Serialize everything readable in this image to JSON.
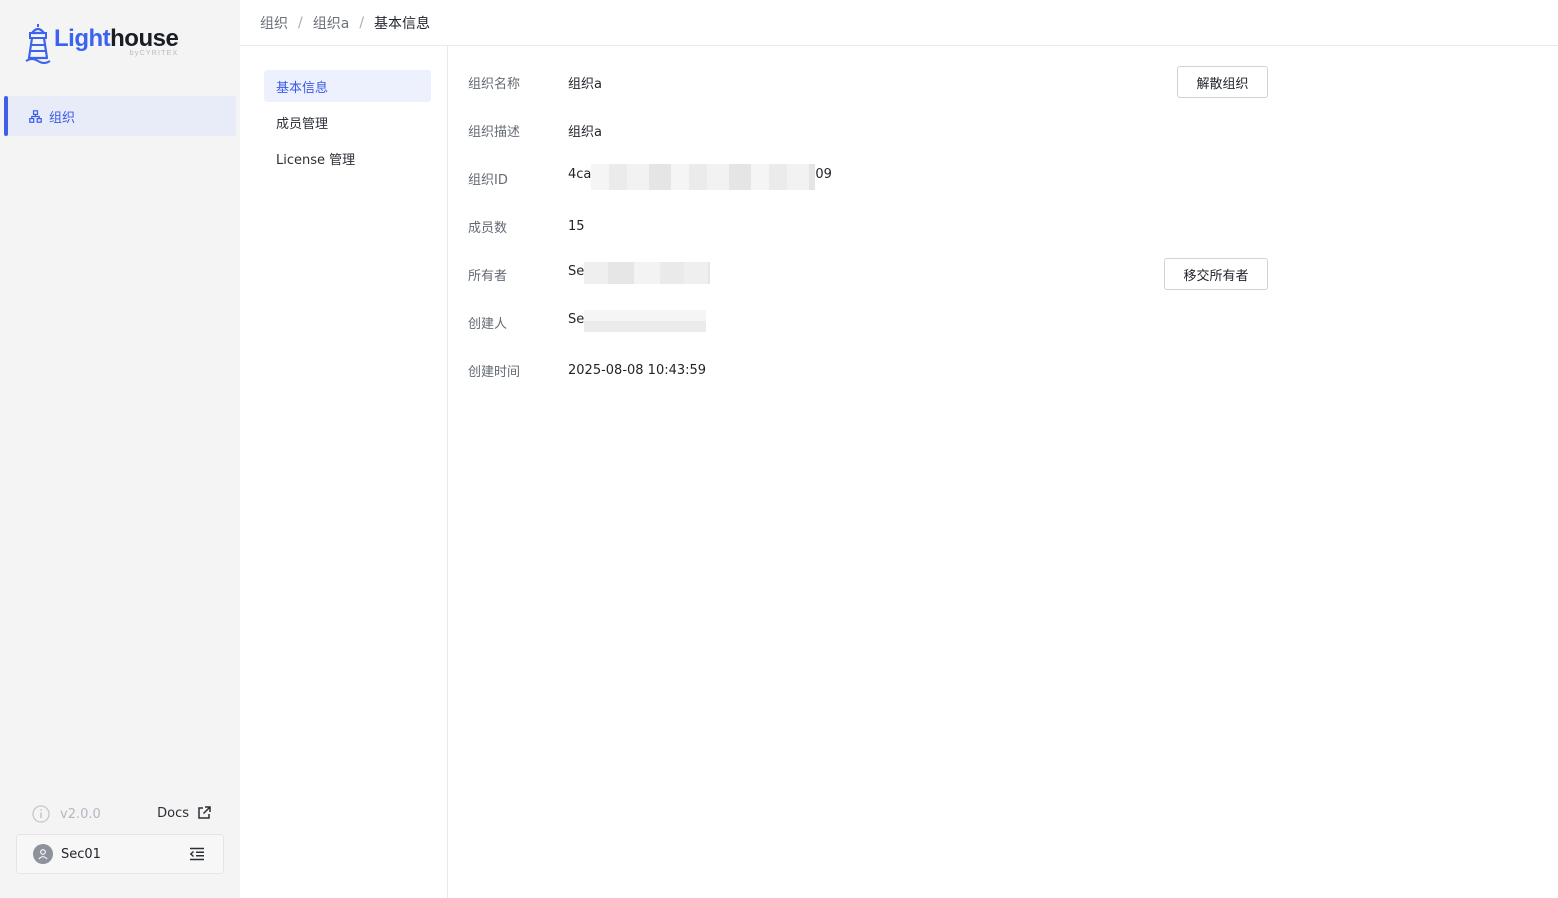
{
  "brand": {
    "word_light": "Light",
    "word_house": "house",
    "tagline": "byCYRITEX",
    "accent": "#3b63f0"
  },
  "sidebar": {
    "items": [
      {
        "label": "组织",
        "icon": "org-icon",
        "active": true
      }
    ],
    "version": "v2.0.0",
    "docs_label": "Docs",
    "user": {
      "name": "Sec01"
    }
  },
  "breadcrumb": [
    "组织",
    "组织a",
    "基本信息"
  ],
  "subnav": [
    {
      "label": "基本信息",
      "active": true
    },
    {
      "label": "成员管理",
      "active": false
    },
    {
      "label": "License 管理",
      "active": false
    }
  ],
  "info": {
    "name_label": "组织名称",
    "name_value": "组织a",
    "desc_label": "组织描述",
    "desc_value": "组织a",
    "id_label": "组织ID",
    "id_prefix": "4ca",
    "id_suffix": "09",
    "members_label": "成员数",
    "members_value": "15",
    "owner_label": "所有者",
    "owner_prefix": "Se",
    "creator_label": "创建人",
    "creator_prefix": "Se",
    "created_label": "创建时间",
    "created_value": "2025-08-08 10:43:59"
  },
  "actions": {
    "dissolve": "解散组织",
    "transfer": "移交所有者"
  }
}
